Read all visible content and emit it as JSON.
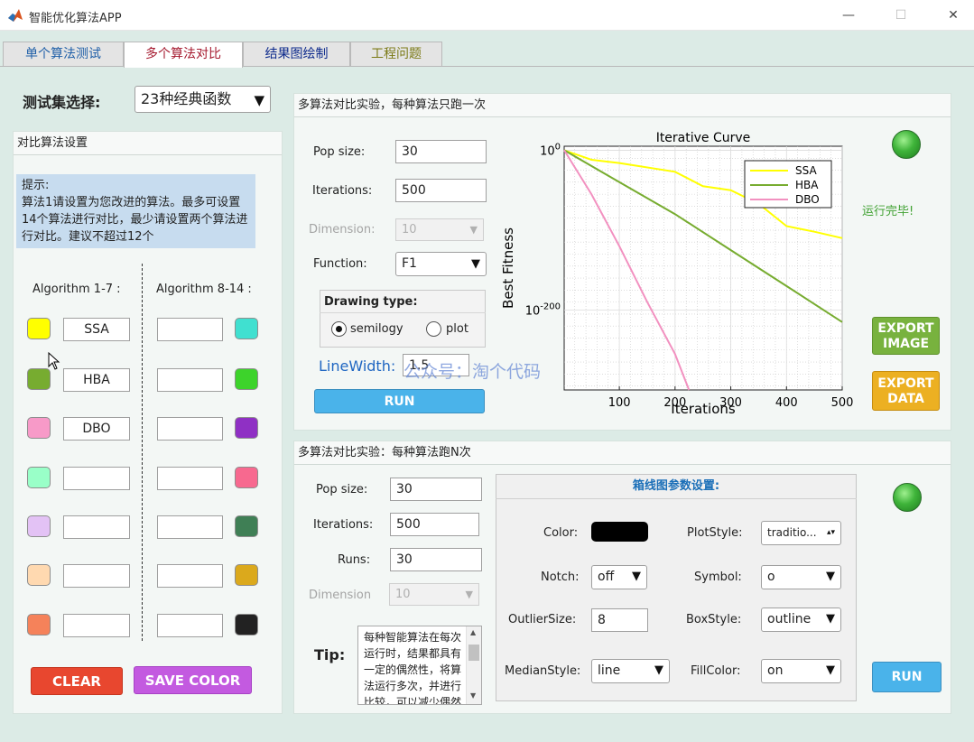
{
  "window": {
    "title": "智能优化算法APP",
    "icon": "matlab-icon",
    "minimize": "—",
    "maximize": "☐",
    "close": "✕"
  },
  "tabs": [
    {
      "label": "单个算法测试",
      "color": "#1f5fa8"
    },
    {
      "label": "多个算法对比",
      "color": "#a5192e"
    },
    {
      "label": "结果图绘制",
      "color": "#0d2a8c"
    },
    {
      "label": "工程问题",
      "color": "#7b7a16"
    }
  ],
  "testset": {
    "label": "测试集选择:",
    "value": "23种经典函数"
  },
  "settings": {
    "title": "对比算法设置",
    "tip": "提示:\n算法1请设置为您改进的算法。最多可设置14个算法进行对比，最少请设置两个算法进行对比。建议不超过12个",
    "col1_label": "Algorithm 1-7 :",
    "col2_label": "Algorithm 8-14 :",
    "left": [
      {
        "name": "SSA",
        "color": "#ffff00"
      },
      {
        "name": "HBA",
        "color": "#77ac30"
      },
      {
        "name": "DBO",
        "color": "#f79ac8"
      },
      {
        "name": "",
        "color": "#99ffc8"
      },
      {
        "name": "",
        "color": "#e3c2f5"
      },
      {
        "name": "",
        "color": "#ffd9b0"
      },
      {
        "name": "",
        "color": "#f5825a"
      }
    ],
    "right": [
      {
        "name": "",
        "color": "#40e0d0"
      },
      {
        "name": "",
        "color": "#3dd32b"
      },
      {
        "name": "",
        "color": "#8f30c4"
      },
      {
        "name": "",
        "color": "#f7698f"
      },
      {
        "name": "",
        "color": "#3f7f55"
      },
      {
        "name": "",
        "color": "#dba91c"
      },
      {
        "name": "",
        "color": "#222222"
      }
    ],
    "clear_label": "CLEAR",
    "save_color_label": "SAVE COLOR"
  },
  "single_run": {
    "title": "多算法对比实验，每种算法只跑一次",
    "pop_label": "Pop size:",
    "pop_value": "30",
    "iter_label": "Iterations:",
    "iter_value": "500",
    "dim_label": "Dimension:",
    "dim_value": "10",
    "func_label": "Function:",
    "func_value": "F1",
    "drawing_label": "Drawing type:",
    "opt_semilogy": "semilogy",
    "opt_plot": "plot",
    "linewidth_label": "LineWidth:",
    "linewidth_value": "1.5",
    "run_label": "RUN",
    "status": "运行完毕!",
    "export_image": "EXPORT IMAGE",
    "export_data": "EXPORT DATA",
    "watermark": "公众号：淘个代码"
  },
  "chart_data": {
    "type": "line",
    "title": "Iterative Curve",
    "xlabel": "Iterations",
    "ylabel": "Best Fitness",
    "xlim": [
      1,
      500
    ],
    "xticks": [
      100,
      200,
      300,
      400,
      500
    ],
    "ylog": true,
    "ylim_exp": [
      -300,
      5
    ],
    "yticks": [
      {
        "base": "10",
        "exp": "0",
        "value_exp": 0
      },
      {
        "base": "10",
        "exp": "-200",
        "value_exp": -200
      }
    ],
    "grid": true,
    "legend_placement": "top-right",
    "series": [
      {
        "name": "SSA",
        "color": "#ffff00",
        "x": [
          1,
          50,
          100,
          200,
          250,
          300,
          350,
          400,
          450,
          500
        ],
        "y_exp": [
          0,
          -12,
          -16,
          -27,
          -45,
          -50,
          -67,
          -95,
          -102,
          -110
        ]
      },
      {
        "name": "HBA",
        "color": "#77ac30",
        "x": [
          1,
          100,
          200,
          300,
          400,
          500
        ],
        "y_exp": [
          0,
          -40,
          -80,
          -125,
          -170,
          -215
        ]
      },
      {
        "name": "DBO",
        "color": "#f291c0",
        "x": [
          1,
          50,
          100,
          150,
          200,
          225
        ],
        "y_exp": [
          0,
          -55,
          -120,
          -190,
          -255,
          -305
        ]
      }
    ]
  },
  "multi_run": {
    "title": "多算法对比实验：每种算法跑N次",
    "pop_label": "Pop size:",
    "pop_value": "30",
    "iter_label": "Iterations:",
    "iter_value": "500",
    "runs_label": "Runs:",
    "runs_value": "30",
    "dim_label": "Dimension",
    "dim_value": "10",
    "tip_label": "Tip:",
    "tip_text": "每种智能算法在每次运行时，结果都具有一定的偶然性，将算法运行多次，并进行比较，可以减少偶然性",
    "run_label": "RUN",
    "box": {
      "title": "箱线图参数设置:",
      "color_label": "Color:",
      "color_value": "#000000",
      "plotstyle_label": "PlotStyle:",
      "plotstyle_value": "traditio...",
      "notch_label": "Notch:",
      "notch_value": "off",
      "symbol_label": "Symbol:",
      "symbol_value": "o",
      "outlier_label": "OutlierSize:",
      "outlier_value": "8",
      "boxstyle_label": "BoxStyle:",
      "boxstyle_value": "outline",
      "median_label": "MedianStyle:",
      "median_value": "line",
      "fill_label": "FillColor:",
      "fill_value": "on"
    }
  }
}
